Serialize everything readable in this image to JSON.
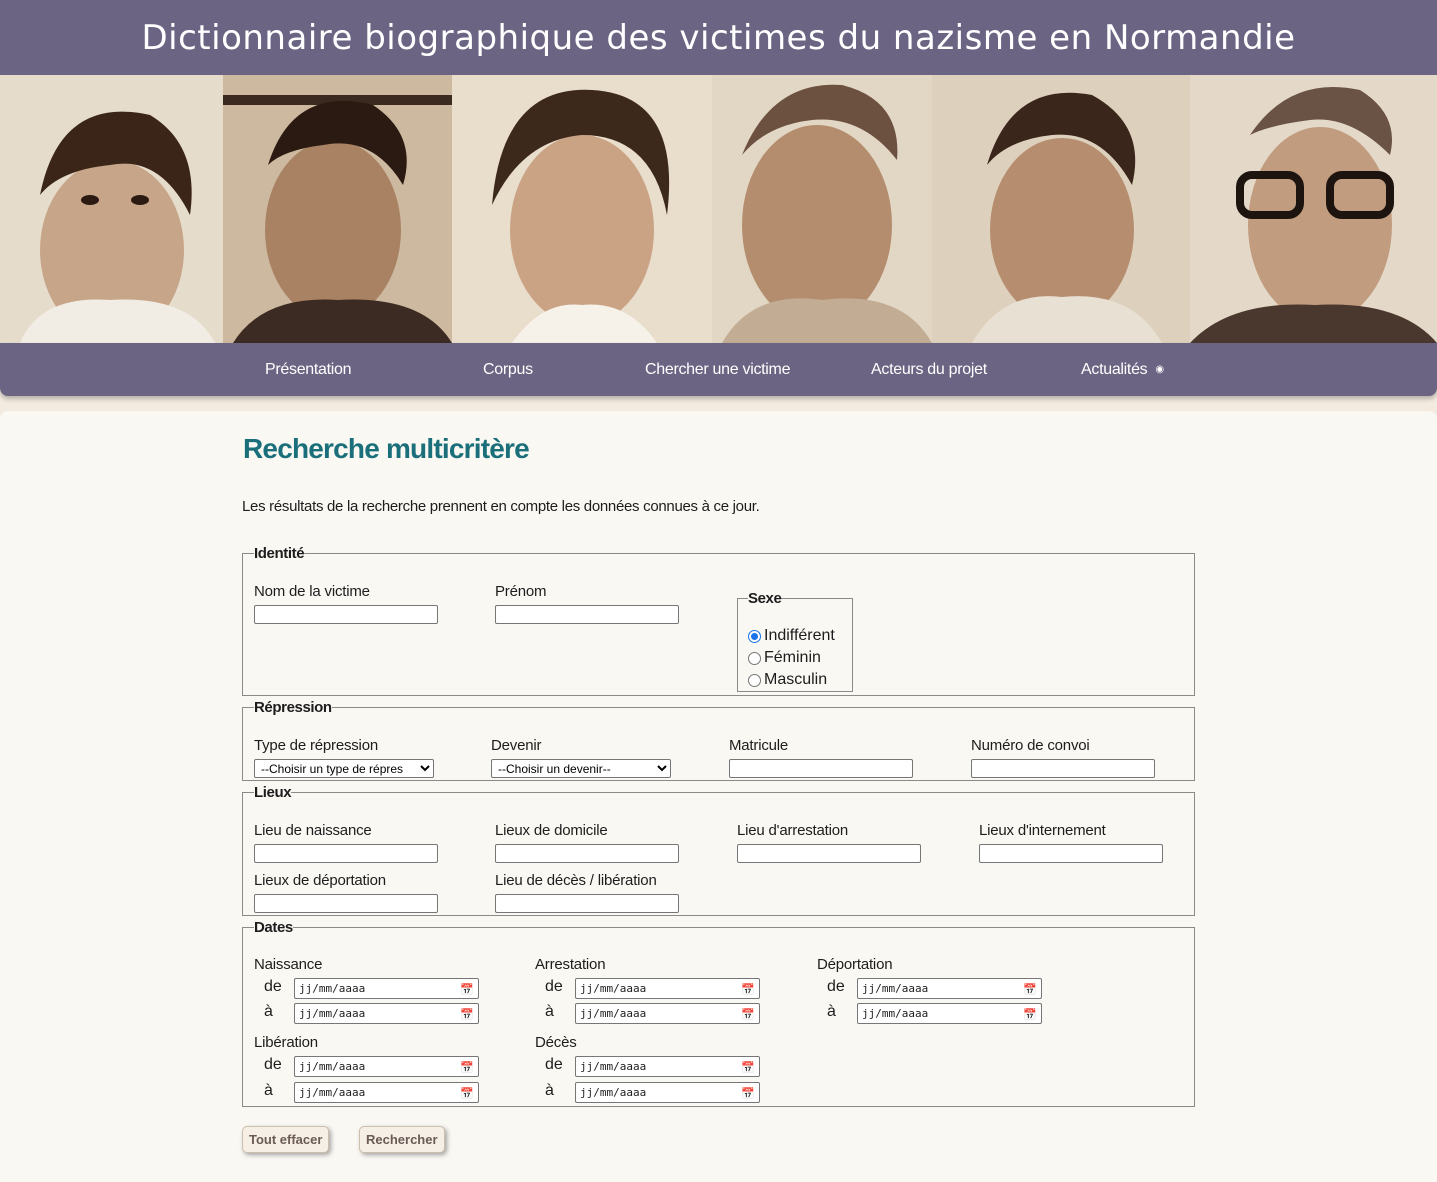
{
  "header": {
    "title": "Dictionnaire biographique des victimes du nazisme en Normandie"
  },
  "nav": {
    "items": [
      {
        "label": "Présentation"
      },
      {
        "label": "Corpus"
      },
      {
        "label": "Chercher une victime"
      },
      {
        "label": "Acteurs du projet"
      },
      {
        "label": "Actualités",
        "icon": "rss-icon"
      }
    ]
  },
  "page": {
    "title": "Recherche multicritère",
    "intro": "Les résultats de la recherche prennent en compte les données connues à ce jour."
  },
  "identite": {
    "legend": "Identité",
    "nom_label": "Nom de la victime",
    "nom_value": "",
    "prenom_label": "Prénom",
    "prenom_value": "",
    "sexe": {
      "legend": "Sexe",
      "options": [
        "Indifférent",
        "Féminin",
        "Masculin"
      ],
      "selected": "Indifférent"
    }
  },
  "repression": {
    "legend": "Répression",
    "type_label": "Type de répression",
    "type_selected": "--Choisir un type de répres",
    "devenir_label": "Devenir",
    "devenir_selected": "--Choisir un devenir--",
    "matricule_label": "Matricule",
    "convoi_label": "Numéro de convoi"
  },
  "lieux": {
    "legend": "Lieux",
    "naissance_label": "Lieu de naissance",
    "domicile_label": "Lieux de domicile",
    "arrestation_label": "Lieu d'arrestation",
    "internement_label": "Lieux d'internement",
    "deportation_label": "Lieux de déportation",
    "deces_label": "Lieu de décès / libération"
  },
  "dates": {
    "legend": "Dates",
    "from_label": "de",
    "to_label": "à",
    "placeholder": "jj/mm/aaaa",
    "naissance": "Naissance",
    "arrestation": "Arrestation",
    "deportation": "Déportation",
    "liberation": "Libération",
    "deces": "Décès"
  },
  "buttons": {
    "clear": "Tout effacer",
    "search": "Rechercher"
  },
  "colors": {
    "nav_bg": "#6b6583",
    "title": "#1a6f7b",
    "page_bg": "#faf8f3"
  }
}
